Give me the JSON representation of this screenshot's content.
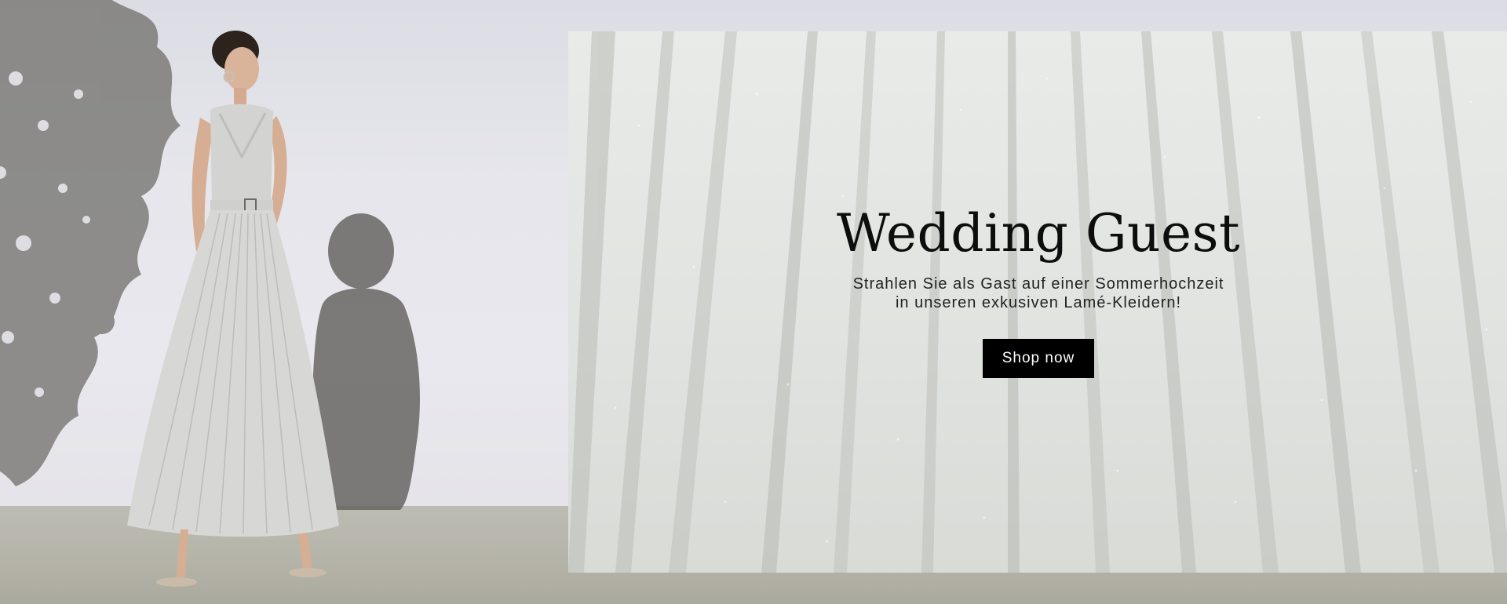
{
  "banner": {
    "title": "Wedding Guest",
    "subtitle_line1": "Strahlen Sie als Gast auf einer Sommerhochzeit",
    "subtitle_line2": "in unseren exkusiven Lamé-Kleidern!",
    "cta_label": "Shop now"
  },
  "colors": {
    "cta_background": "#000000",
    "cta_text": "#ffffff",
    "title": "#0d0d0d",
    "wall": "#e6e6ec",
    "floor": "#b4b3a8",
    "fabric": "#e2e4e1"
  }
}
